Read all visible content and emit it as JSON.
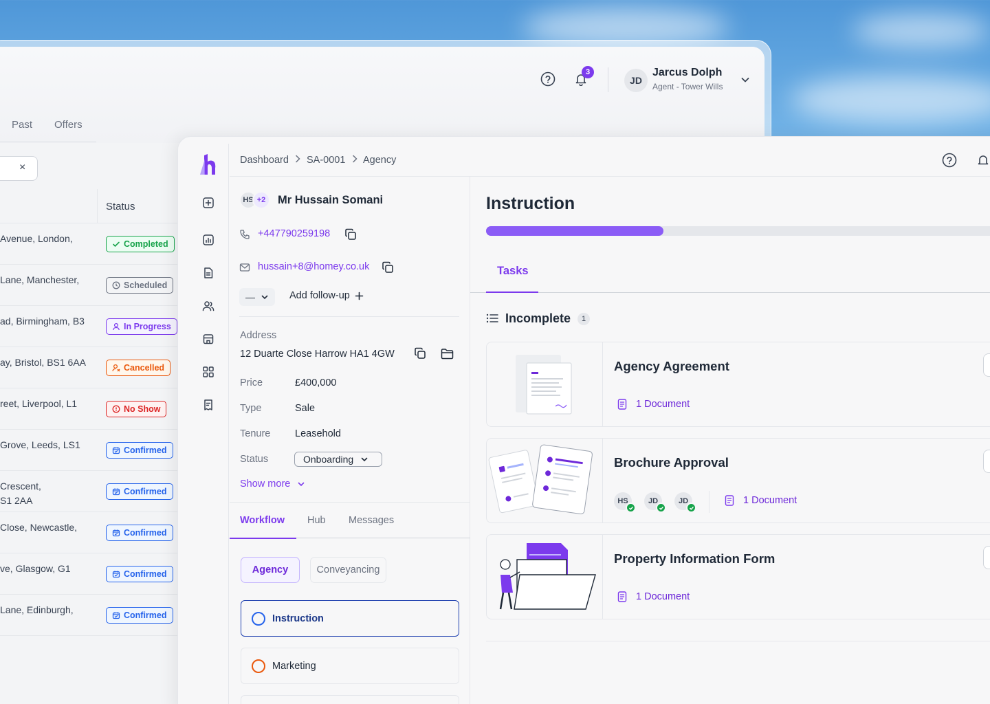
{
  "back_window": {
    "notifications_count": "3",
    "user": {
      "initials": "JD",
      "name": "Jarcus Dolph",
      "role": "Agent - Tower Wills"
    },
    "tabs": [
      "Past",
      "Offers"
    ],
    "search_clear": "×",
    "status_header": "Status",
    "rows": [
      {
        "address": "Avenue, London,",
        "address2": "",
        "status": "Completed"
      },
      {
        "address": "Lane, Manchester,",
        "address2": "",
        "status": "Scheduled"
      },
      {
        "address": "ad, Birmingham, B3",
        "address2": "",
        "status": "In Progress"
      },
      {
        "address": "ay, Bristol, BS1 6AA",
        "address2": "",
        "status": "Cancelled"
      },
      {
        "address": "reet, Liverpool, L1",
        "address2": "",
        "status": "No Show"
      },
      {
        "address": "Grove, Leeds, LS1",
        "address2": "",
        "status": "Confirmed"
      },
      {
        "address": "Crescent,",
        "address2": "S1 2AA",
        "status": "Confirmed"
      },
      {
        "address": "Close, Newcastle,",
        "address2": "",
        "status": "Confirmed"
      },
      {
        "address": "ve, Glasgow, G1",
        "address2": "",
        "status": "Confirmed"
      },
      {
        "address": " Lane, Edinburgh,",
        "address2": "",
        "status": "Confirmed"
      }
    ],
    "status_colors": {
      "Completed": "#16a34a",
      "Scheduled": "#6b7280",
      "In Progress": "#7c3aed",
      "Cancelled": "#ea580c",
      "No Show": "#dc2626",
      "Confirmed": "#2563eb"
    }
  },
  "front_window": {
    "breadcrumb": [
      "Dashboard",
      "SA-0001",
      "Agency"
    ],
    "contact": {
      "avatar_initials": "HS",
      "extra_count": "+2",
      "name": "Mr Hussain Somani",
      "phone": "+447790259198",
      "email": "hussain+8@homey.co.uk",
      "followup_value": "—",
      "add_followup": "Add follow-up"
    },
    "details": {
      "address_label": "Address",
      "address": "12 Duarte Close Harrow HA1 4GW",
      "price_label": "Price",
      "price": "£400,000",
      "type_label": "Type",
      "type": "Sale",
      "tenure_label": "Tenure",
      "tenure": "Leasehold",
      "status_label": "Status",
      "status": "Onboarding",
      "show_more": "Show more"
    },
    "workflow_tabs": [
      "Workflow",
      "Hub",
      "Messages"
    ],
    "chips": [
      "Agency",
      "Conveyancing"
    ],
    "stages": [
      "Instruction",
      "Marketing"
    ],
    "instruction": {
      "title": "Instruction",
      "progress": 0.34,
      "tab": "Tasks",
      "group_label": "Incomplete",
      "group_count": "1",
      "tasks": [
        {
          "title": "Agency Agreement",
          "documents": "1 Document",
          "assignees": []
        },
        {
          "title": "Brochure Approval",
          "documents": "1 Document",
          "assignees": [
            "HS",
            "JD",
            "JD"
          ]
        },
        {
          "title": "Property Information Form",
          "documents": "1 Document",
          "assignees": []
        }
      ]
    }
  },
  "colors": {
    "accent": "#7c3aed",
    "accent_light": "#8b5cf6",
    "marketing_ring": "#ea580c"
  }
}
